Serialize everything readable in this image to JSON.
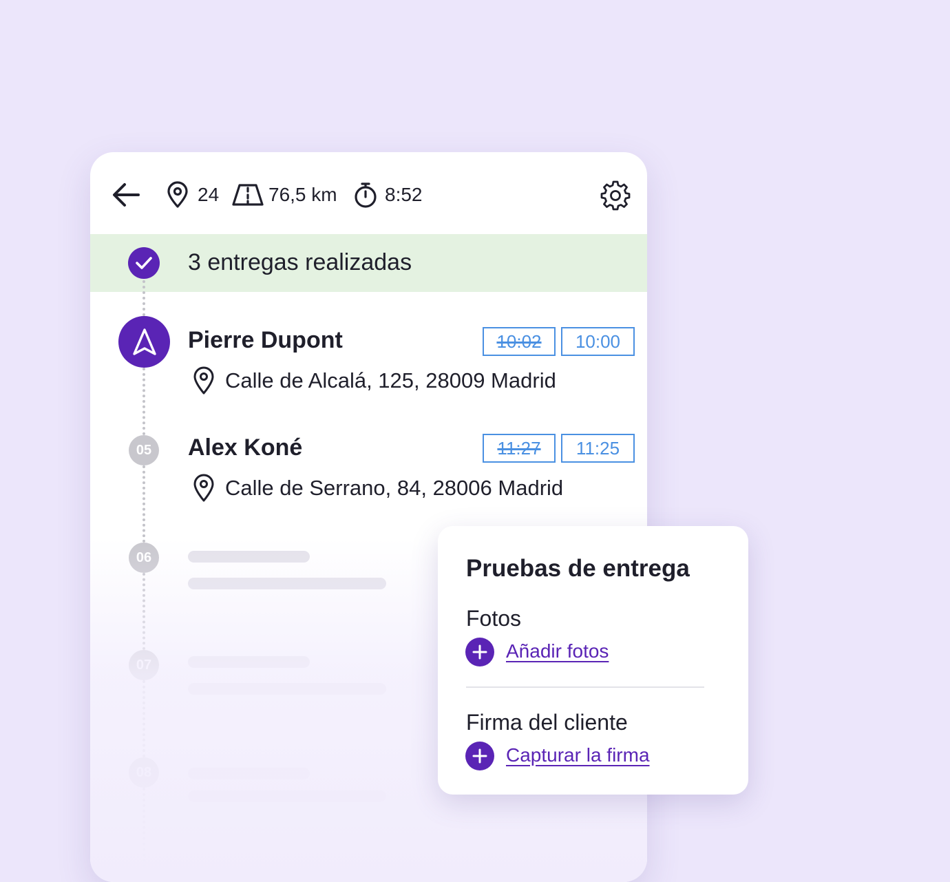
{
  "header": {
    "stops_count": "24",
    "distance": "76,5 km",
    "duration": "8:52",
    "icons": [
      "back-arrow-icon",
      "location-pin-icon",
      "road-icon",
      "stopwatch-icon",
      "gear-icon"
    ]
  },
  "banner": {
    "text": "3 entregas realizadas"
  },
  "stops": [
    {
      "name": "Pierre Dupont",
      "address": "Calle de Alcalá, 125, 28009 Madrid",
      "time_old": "10:02",
      "time_new": "10:00"
    },
    {
      "number": "05",
      "name": "Alex Koné",
      "address": "Calle de Serrano, 84, 28006 Madrid",
      "time_old": "11:27",
      "time_new": "11:25"
    },
    {
      "number": "06"
    },
    {
      "number": "07"
    },
    {
      "number": "08"
    }
  ],
  "proof_card": {
    "title": "Pruebas de entrega",
    "photos_label": "Fotos",
    "photos_action": "Añadir fotos",
    "signature_label": "Firma del cliente",
    "signature_action": "Capturar la firma"
  },
  "colors": {
    "background": "#ece6fb",
    "brand_purple": "#5a24b5",
    "banner_green": "#e4f2e1",
    "time_blue": "#4a90e2",
    "pending_grey": "#c8c7cd"
  }
}
